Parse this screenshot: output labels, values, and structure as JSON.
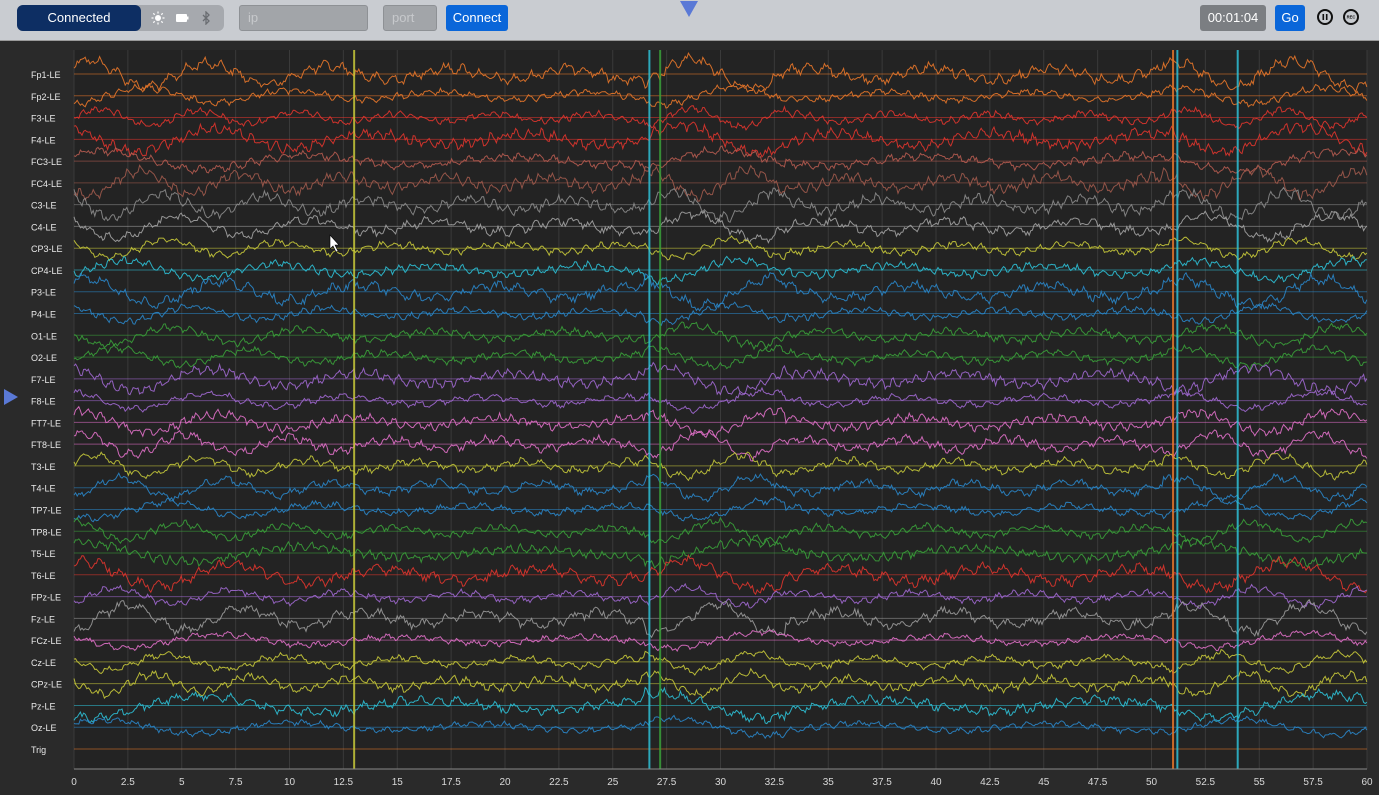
{
  "toolbar": {
    "status_label": "Connected",
    "icons": [
      "brightness-icon",
      "battery-icon",
      "bluetooth-icon"
    ],
    "ip_placeholder": "ip",
    "port_placeholder": "port",
    "connect_label": "Connect",
    "timer_value": "00:01:04",
    "go_label": "Go",
    "pause_label": "II",
    "rec_label": "REC"
  },
  "colors": {
    "accent": "#0a66d9",
    "status_bg": "#0d2e63",
    "plot_bg": "#2a2a2a",
    "marker": "#5a79d6"
  },
  "chart_data": {
    "type": "line",
    "xlim": [
      0,
      60
    ],
    "x_ticks": [
      "0",
      "2.5",
      "5",
      "7.5",
      "10",
      "12.5",
      "15",
      "17.5",
      "20",
      "22.5",
      "25",
      "27.5",
      "30",
      "32.5",
      "35",
      "37.5",
      "40",
      "42.5",
      "45",
      "47.5",
      "50",
      "52.5",
      "55",
      "57.5",
      "60"
    ],
    "channels": [
      {
        "name": "Fp1-LE",
        "color": "#e8772a"
      },
      {
        "name": "Fp2-LE",
        "color": "#e8772a"
      },
      {
        "name": "F3-LE",
        "color": "#e0352d"
      },
      {
        "name": "F4-LE",
        "color": "#e0352d"
      },
      {
        "name": "FC3-LE",
        "color": "#b55b50"
      },
      {
        "name": "FC4-LE",
        "color": "#a05a4c"
      },
      {
        "name": "C3-LE",
        "color": "#8c8c8c"
      },
      {
        "name": "C4-LE",
        "color": "#a3a3a3"
      },
      {
        "name": "CP3-LE",
        "color": "#c8c93a"
      },
      {
        "name": "CP4-LE",
        "color": "#2ec0d6"
      },
      {
        "name": "P3-LE",
        "color": "#2a86c9"
      },
      {
        "name": "P4-LE",
        "color": "#2a86c9"
      },
      {
        "name": "O1-LE",
        "color": "#3aa03a"
      },
      {
        "name": "O2-LE",
        "color": "#3aa03a"
      },
      {
        "name": "F7-LE",
        "color": "#a068d0"
      },
      {
        "name": "F8-LE",
        "color": "#a068d0"
      },
      {
        "name": "FT7-LE",
        "color": "#e070c8"
      },
      {
        "name": "FT8-LE",
        "color": "#e070c8"
      },
      {
        "name": "T3-LE",
        "color": "#c3c63a"
      },
      {
        "name": "T4-LE",
        "color": "#2a86c9"
      },
      {
        "name": "TP7-LE",
        "color": "#2a86c9"
      },
      {
        "name": "TP8-LE",
        "color": "#3aa03a"
      },
      {
        "name": "T5-LE",
        "color": "#3aa03a"
      },
      {
        "name": "T6-LE",
        "color": "#e0352d"
      },
      {
        "name": "FPz-LE",
        "color": "#a068d0"
      },
      {
        "name": "Fz-LE",
        "color": "#9a9a9a"
      },
      {
        "name": "FCz-LE",
        "color": "#e070c8"
      },
      {
        "name": "Cz-LE",
        "color": "#c8c93a"
      },
      {
        "name": "CPz-LE",
        "color": "#c8c93a"
      },
      {
        "name": "Pz-LE",
        "color": "#2ec0d6"
      },
      {
        "name": "Oz-LE",
        "color": "#2a86c9"
      },
      {
        "name": "Trig",
        "color": "#e8772a"
      }
    ],
    "artifact_times": [
      13.0,
      26.7,
      27.2,
      51.0,
      51.2,
      54.0
    ]
  }
}
